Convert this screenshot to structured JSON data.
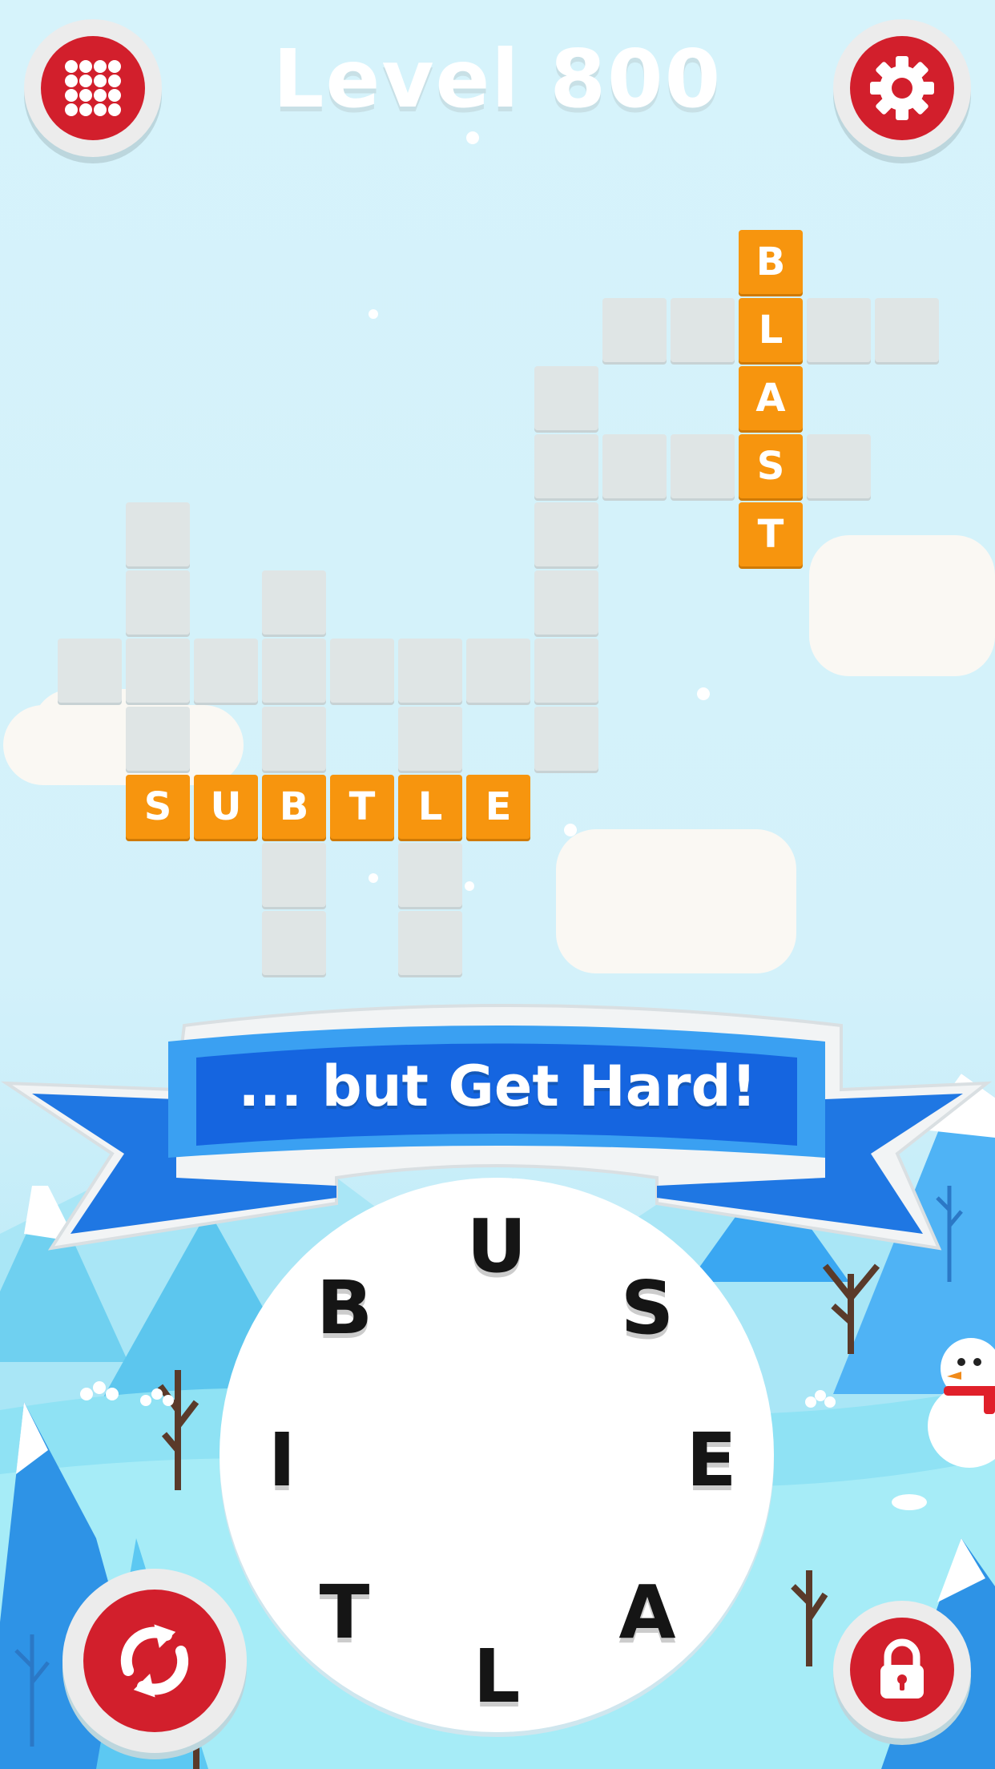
{
  "header": {
    "title": "Level 800",
    "menu_icon": "grid-menu-icon",
    "settings_icon": "gear-icon"
  },
  "banner": {
    "text": "... but Get Hard!"
  },
  "crossword": {
    "found_words": [
      "BLAST",
      "SUBTLE"
    ],
    "blast_letters": [
      "B",
      "L",
      "A",
      "S",
      "T"
    ],
    "subtle_letters": [
      "S",
      "U",
      "B",
      "T",
      "L",
      "E"
    ]
  },
  "wheel": {
    "letters": [
      "U",
      "S",
      "E",
      "A",
      "L",
      "T",
      "I",
      "B"
    ]
  },
  "controls": {
    "shuffle_icon": "shuffle-icon",
    "hint_icon": "lock-icon"
  },
  "colors": {
    "accent_red": "#d21f2c",
    "tile_orange": "#f7950e",
    "banner_blue": "#1d72e8",
    "sky": "#d6f3fb"
  }
}
